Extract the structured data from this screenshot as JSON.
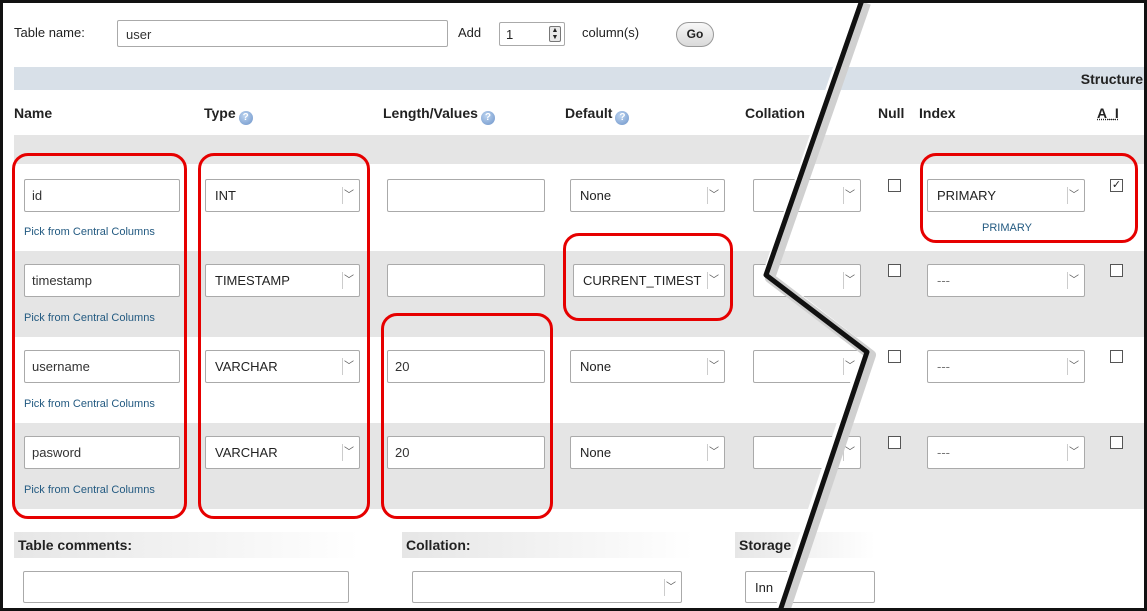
{
  "top": {
    "table_name_label": "Table name:",
    "table_name_value": "user",
    "add_label": "Add",
    "add_value": "1",
    "columns_label": "column(s)",
    "go_label": "Go"
  },
  "structure_label": "Structure",
  "headers": {
    "name": "Name",
    "type": "Type",
    "length": "Length/Values",
    "default": "Default",
    "collation": "Collation",
    "null": "Null",
    "index": "Index",
    "ai": "A_I"
  },
  "help_icon": "question-mark-icon",
  "pick_link": "Pick from Central Columns",
  "rows": [
    {
      "name": "id",
      "type": "INT",
      "length": "",
      "default": "None",
      "collation": "",
      "null": false,
      "index": "PRIMARY",
      "index_link": "PRIMARY",
      "ai": true
    },
    {
      "name": "timestamp",
      "type": "TIMESTAMP",
      "length": "",
      "default": "CURRENT_TIMEST",
      "collation": "",
      "null": false,
      "index": "---",
      "index_link": "",
      "ai": false
    },
    {
      "name": "username",
      "type": "VARCHAR",
      "length": "20",
      "default": "None",
      "collation": "",
      "null": false,
      "index": "---",
      "index_link": "",
      "ai": false
    },
    {
      "name": "pasword",
      "type": "VARCHAR",
      "length": "20",
      "default": "None",
      "collation": "",
      "null": false,
      "index": "---",
      "index_link": "",
      "ai": false
    }
  ],
  "footer": {
    "table_comments_label": "Table comments:",
    "table_comments_value": "",
    "collation_label": "Collation:",
    "collation_value": "",
    "storage_label": "Storage",
    "storage_value": "Inn"
  },
  "colors": {
    "highlight": "#e60000",
    "link": "#235a81",
    "band": "#d8e0e8",
    "row_alt": "#e5e5e5"
  }
}
